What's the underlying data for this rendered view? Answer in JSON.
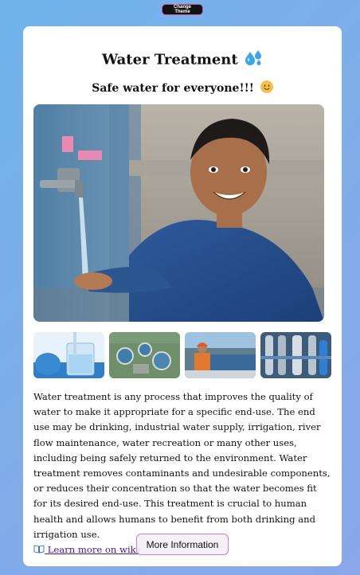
{
  "theme_button": {
    "label": "Change Theme"
  },
  "card": {
    "title": "Water Treatment",
    "title_icon": "water-droplets-icon",
    "subtitle": "Safe water for everyone!!!",
    "subtitle_icon": "smiling-face-icon",
    "hero_image": {
      "icon": "child-washing-hands-photo"
    },
    "thumbnails": [
      {
        "icon": "glass-of-water-photo"
      },
      {
        "icon": "treatment-plant-aerial-photo"
      },
      {
        "icon": "worker-at-tank-photo"
      },
      {
        "icon": "filtration-pipes-photo"
      }
    ],
    "description": "Water treatment is any process that improves the quality of water to make it appropriate for a specific end-use. The end use may be drinking, industrial water supply, irrigation, river flow maintenance, water recreation or many other uses, including being safely returned to the environment. Water treatment removes contaminants and undesirable components, or reduces their concentration so that the water becomes fit for its desired end-use. This treatment is crucial to human health and allows humans to benefit from both drinking and irrigation use.",
    "wiki_link": {
      "icon": "open-book-icon",
      "label": "Learn more on wiki"
    },
    "more_button": {
      "label": "More Information"
    }
  },
  "colors": {
    "background_start": "#6fb4ec",
    "background_end": "#8aa8ea",
    "button_border": "#d47ac8",
    "link": "#4b1a89"
  }
}
